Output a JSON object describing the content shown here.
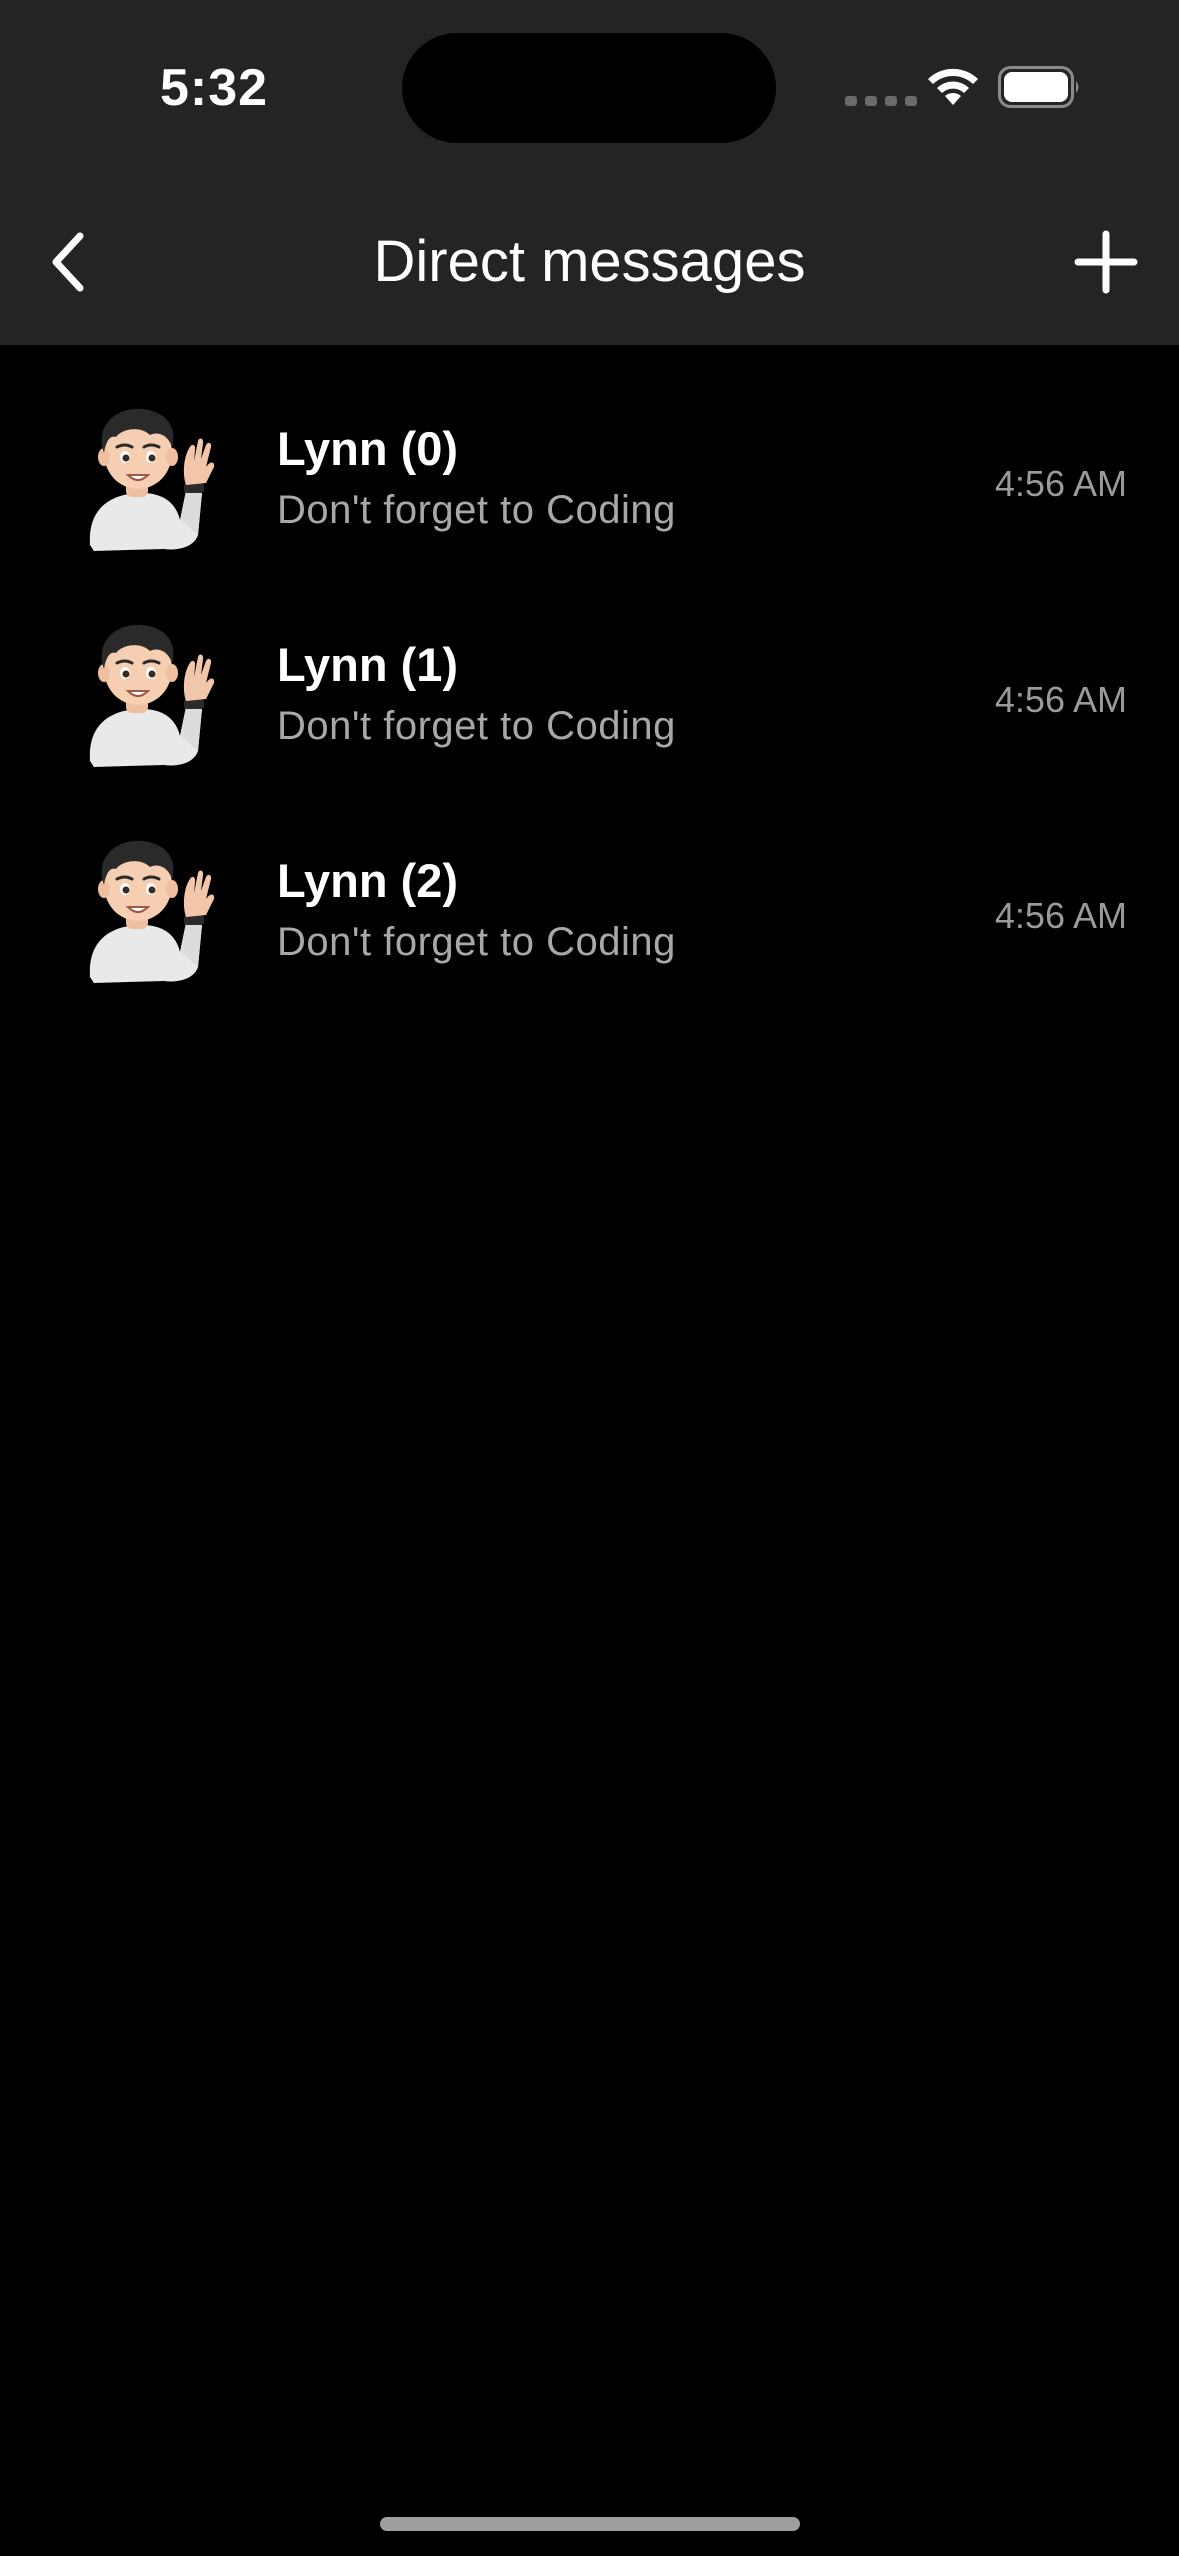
{
  "status_bar": {
    "time": "5:32",
    "icons": [
      "cellular-signal-icon",
      "wifi-icon",
      "battery-icon"
    ]
  },
  "nav": {
    "back_icon": "chevron-left-icon",
    "title": "Direct messages",
    "add_icon": "plus-icon"
  },
  "conversations": [
    {
      "name": "Lynn (0)",
      "preview": "Don't forget to Coding",
      "time": "4:56 AM",
      "avatar_icon": "memoji-waving-avatar"
    },
    {
      "name": "Lynn (1)",
      "preview": "Don't forget to Coding",
      "time": "4:56 AM",
      "avatar_icon": "memoji-waving-avatar"
    },
    {
      "name": "Lynn (2)",
      "preview": "Don't forget to Coding",
      "time": "4:56 AM",
      "avatar_icon": "memoji-waving-avatar"
    }
  ],
  "colors": {
    "background": "#000000",
    "header": "#242424",
    "primary_text": "#ffffff",
    "secondary_text": "#a8a8a8"
  }
}
